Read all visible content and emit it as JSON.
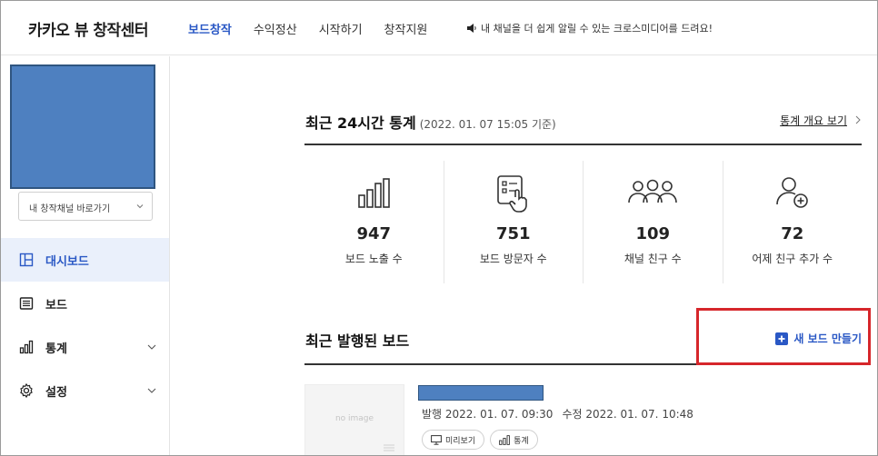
{
  "header": {
    "logo": "카카오 뷰 창작센터",
    "nav": [
      {
        "label": "보드창작",
        "active": true
      },
      {
        "label": "수익정산",
        "active": false
      },
      {
        "label": "시작하기",
        "active": false
      },
      {
        "label": "창작지원",
        "active": false
      }
    ],
    "notice": "내 채널을 더 쉽게 알릴 수 있는 크로스미디어를 드려요!"
  },
  "sidebar": {
    "channel_select": "내 창작채널 바로가기",
    "menu": [
      {
        "label": "대시보드",
        "icon": "dashboard-icon",
        "active": true
      },
      {
        "label": "보드",
        "icon": "board-icon",
        "active": false
      },
      {
        "label": "통계",
        "icon": "chart-icon",
        "active": false
      },
      {
        "label": "설정",
        "icon": "gear-icon",
        "active": false
      }
    ]
  },
  "stats": {
    "title": "최근 24시간 통계",
    "subtitle": "(2022. 01. 07 15:05 기준)",
    "link": "통계 개요 보기",
    "cards": [
      {
        "value": "947",
        "label": "보드 노출 수",
        "icon": "bar-chart-icon"
      },
      {
        "value": "751",
        "label": "보드 방문자 수",
        "icon": "touch-list-icon"
      },
      {
        "value": "109",
        "label": "채널 친구 수",
        "icon": "group-icon"
      },
      {
        "value": "72",
        "label": "어제 친구 추가 수",
        "icon": "add-user-icon"
      }
    ]
  },
  "recent": {
    "title": "최근 발행된 보드",
    "new_board": "새 보드 만들기",
    "boards": [
      {
        "thumb_text": "no image",
        "published": "발행 2022. 01. 07. 09:30",
        "modified": "수정 2022. 01. 07. 10:48",
        "preview": "미리보기",
        "stats": "통계"
      }
    ]
  },
  "colors": {
    "accent": "#2a58c5",
    "highlight": "#d6262b",
    "redacted": "#4e80c0"
  }
}
